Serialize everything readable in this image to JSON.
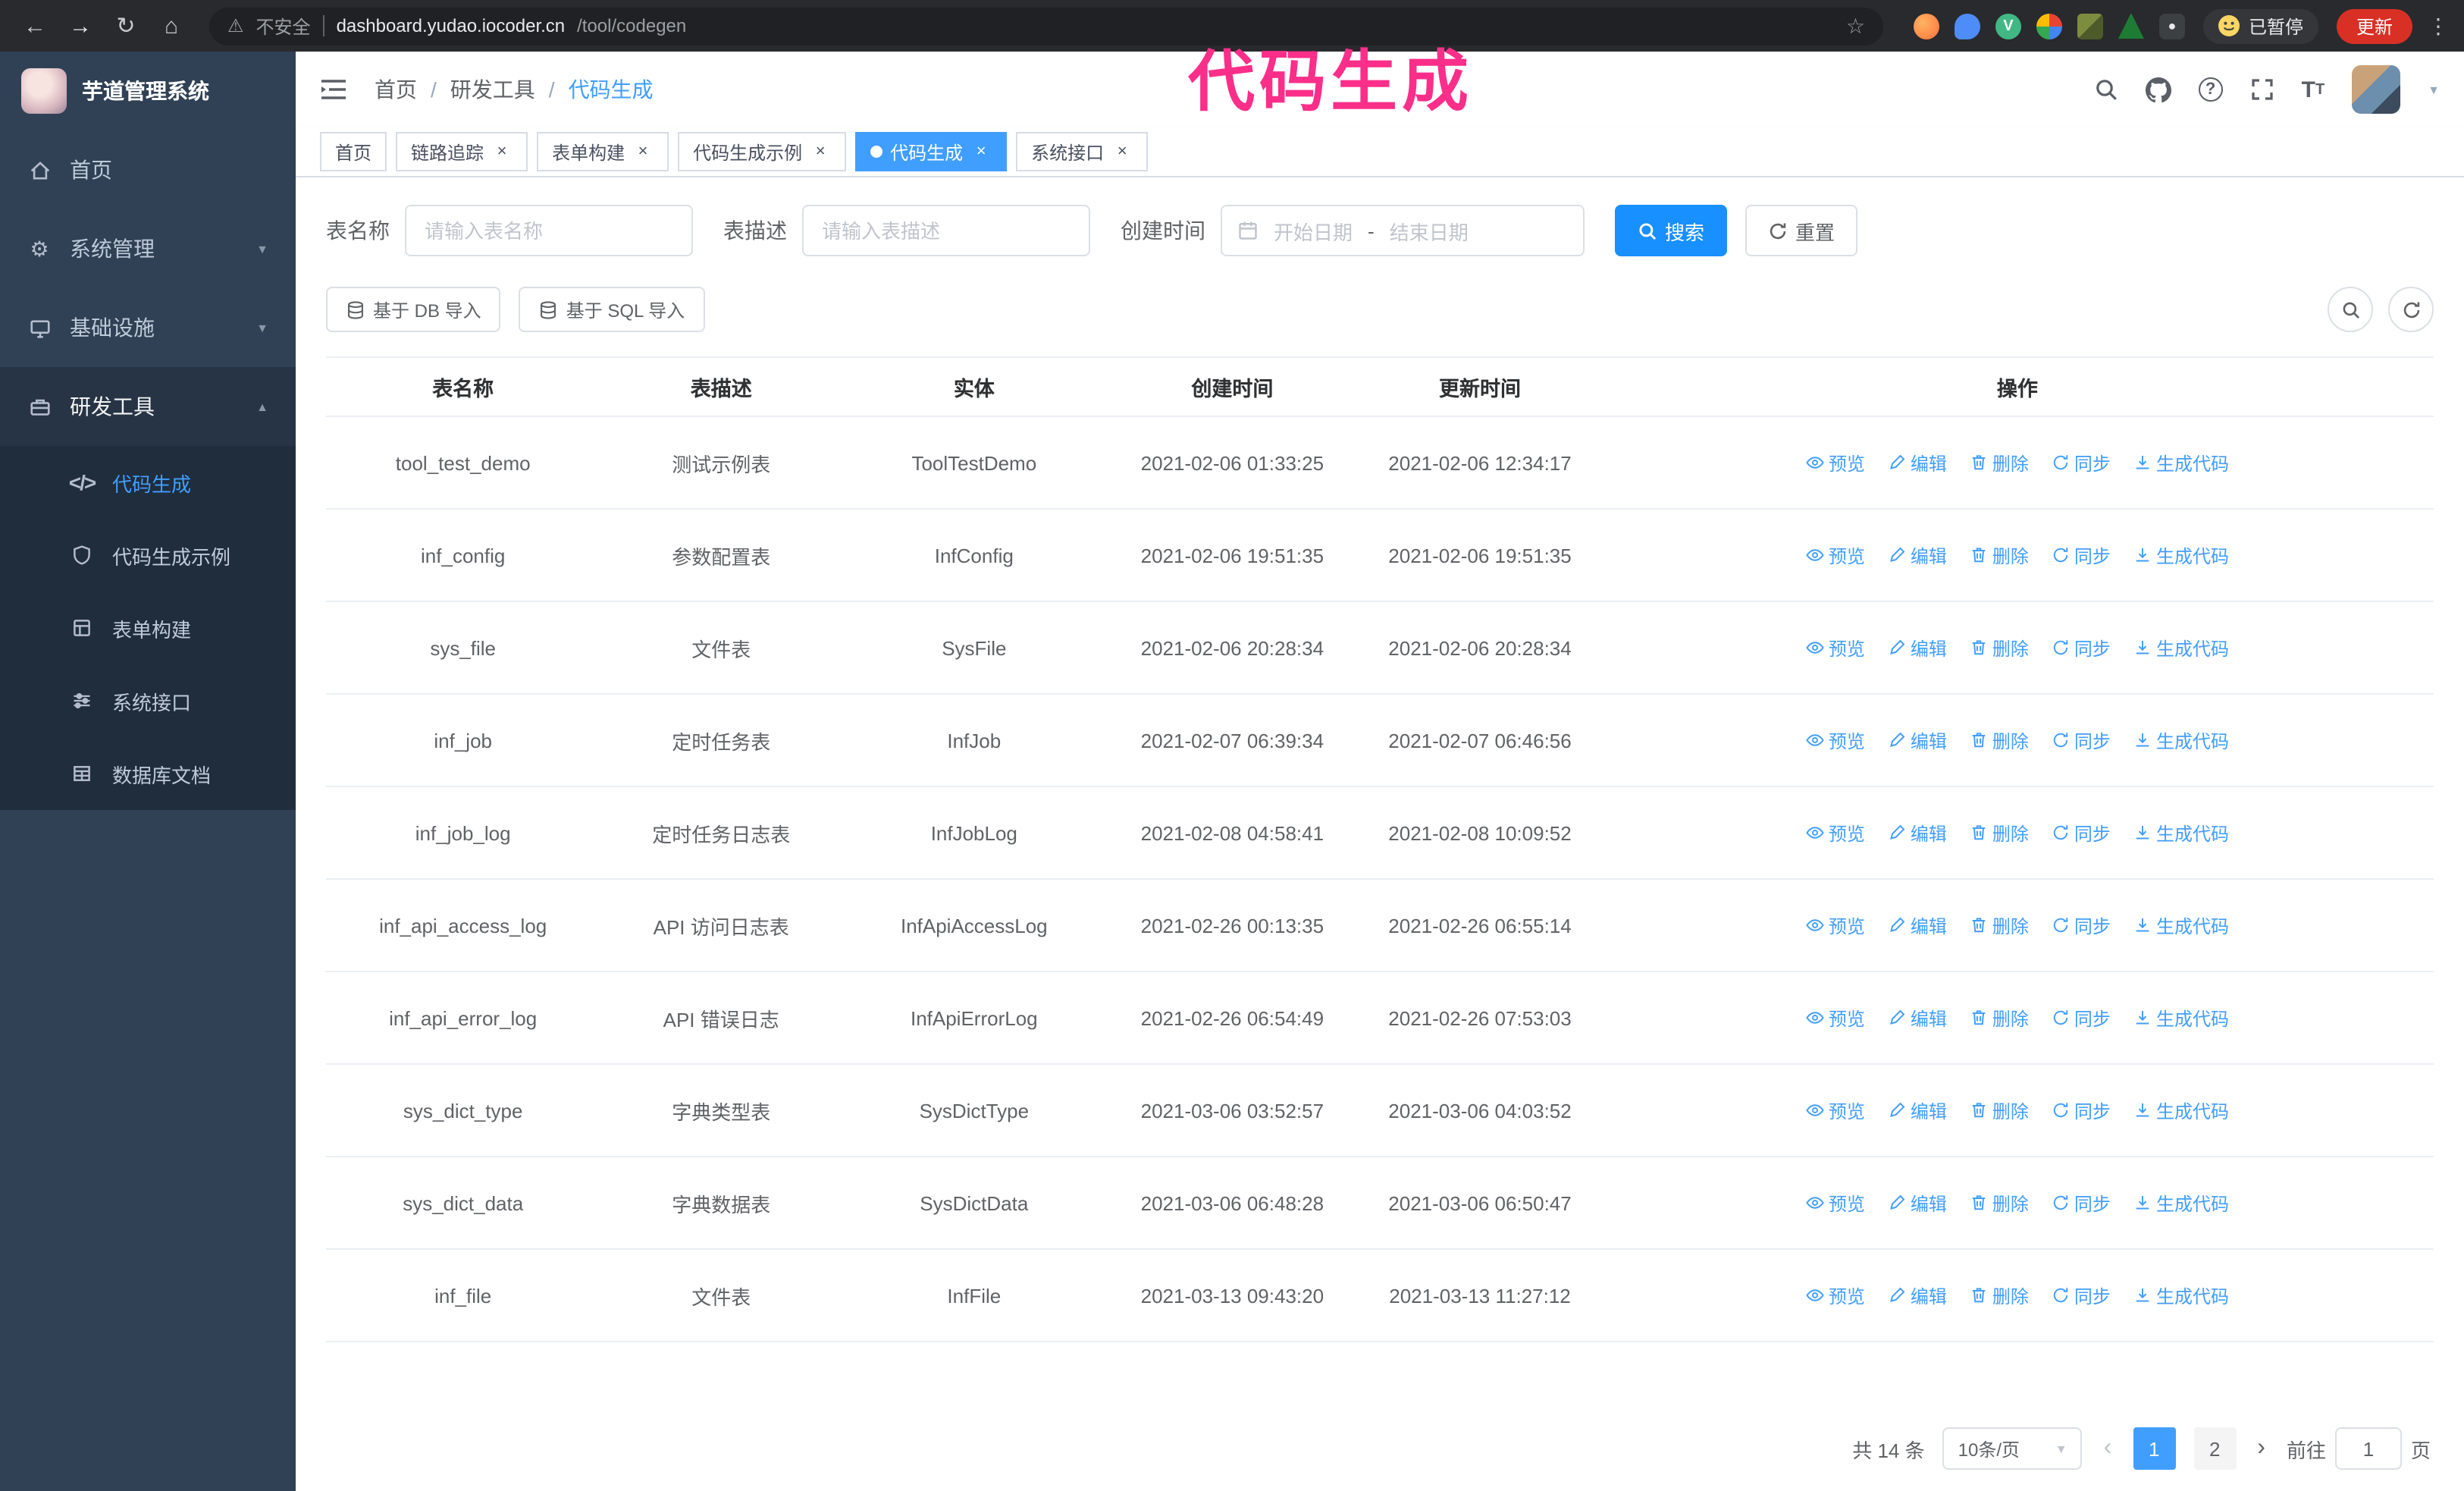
{
  "browser": {
    "security_label": "不安全",
    "url_domain": "dashboard.yudao.iocoder.cn",
    "url_path": "/tool/codegen",
    "paused_badge": "已暂停",
    "update_button": "更新",
    "vue_ext_letter": "V"
  },
  "annotation": "代码生成",
  "colors": {
    "accent": "#409eff",
    "search_button": "#1890ff",
    "sidebar_bg": "#304156",
    "submenu_bg": "#1f2d3d",
    "annotation_pink": "#fb2e8a",
    "update_button_red": "#d93025",
    "tag_active": "#409eff"
  },
  "sidebar": {
    "logo_title": "芋道管理系统",
    "items": [
      {
        "label": "首页"
      },
      {
        "label": "系统管理"
      },
      {
        "label": "基础设施"
      },
      {
        "label": "研发工具"
      }
    ],
    "subitems": [
      {
        "label": "代码生成",
        "active": true
      },
      {
        "label": "代码生成示例"
      },
      {
        "label": "表单构建"
      },
      {
        "label": "系统接口"
      },
      {
        "label": "数据库文档"
      }
    ]
  },
  "header": {
    "breadcrumb": [
      "首页",
      "研发工具",
      "代码生成"
    ]
  },
  "tabs": [
    {
      "label": "首页"
    },
    {
      "label": "链路追踪"
    },
    {
      "label": "表单构建"
    },
    {
      "label": "代码生成示例"
    },
    {
      "label": "代码生成"
    },
    {
      "label": "系统接口"
    }
  ],
  "filters": {
    "table_name_label": "表名称",
    "table_name_placeholder": "请输入表名称",
    "table_desc_label": "表描述",
    "table_desc_placeholder": "请输入表描述",
    "create_time_label": "创建时间",
    "date_start_placeholder": "开始日期",
    "date_separator": "-",
    "date_end_placeholder": "结束日期",
    "search_button": "搜索",
    "reset_button": "重置"
  },
  "toolbar": {
    "import_db_button": "基于 DB 导入",
    "import_sql_button": "基于 SQL 导入"
  },
  "table": {
    "columns": [
      "表名称",
      "表描述",
      "实体",
      "创建时间",
      "更新时间",
      "操作"
    ],
    "actions": [
      "预览",
      "编辑",
      "删除",
      "同步",
      "生成代码"
    ],
    "rows": [
      {
        "name": "tool_test_demo",
        "desc": "测试示例表",
        "entity": "ToolTestDemo",
        "created": "2021-02-06 01:33:25",
        "updated": "2021-02-06 12:34:17"
      },
      {
        "name": "inf_config",
        "desc": "参数配置表",
        "entity": "InfConfig",
        "created": "2021-02-06 19:51:35",
        "updated": "2021-02-06 19:51:35"
      },
      {
        "name": "sys_file",
        "desc": "文件表",
        "entity": "SysFile",
        "created": "2021-02-06 20:28:34",
        "updated": "2021-02-06 20:28:34"
      },
      {
        "name": "inf_job",
        "desc": "定时任务表",
        "entity": "InfJob",
        "created": "2021-02-07 06:39:34",
        "updated": "2021-02-07 06:46:56"
      },
      {
        "name": "inf_job_log",
        "desc": "定时任务日志表",
        "entity": "InfJobLog",
        "created": "2021-02-08 04:58:41",
        "updated": "2021-02-08 10:09:52"
      },
      {
        "name": "inf_api_access_log",
        "desc": "API 访问日志表",
        "entity": "InfApiAccessLog",
        "created": "2021-02-26 00:13:35",
        "updated": "2021-02-26 06:55:14"
      },
      {
        "name": "inf_api_error_log",
        "desc": "API 错误日志",
        "entity": "InfApiErrorLog",
        "created": "2021-02-26 06:54:49",
        "updated": "2021-02-26 07:53:03"
      },
      {
        "name": "sys_dict_type",
        "desc": "字典类型表",
        "entity": "SysDictType",
        "created": "2021-03-06 03:52:57",
        "updated": "2021-03-06 04:03:52"
      },
      {
        "name": "sys_dict_data",
        "desc": "字典数据表",
        "entity": "SysDictData",
        "created": "2021-03-06 06:48:28",
        "updated": "2021-03-06 06:50:47"
      },
      {
        "name": "inf_file",
        "desc": "文件表",
        "entity": "InfFile",
        "created": "2021-03-13 09:43:20",
        "updated": "2021-03-13 11:27:12"
      }
    ]
  },
  "pagination": {
    "total": "共 14 条",
    "page_size": "10条/页",
    "pages": [
      "1",
      "2"
    ],
    "goto_label": "前往",
    "goto_value": "1",
    "goto_suffix": "页"
  }
}
